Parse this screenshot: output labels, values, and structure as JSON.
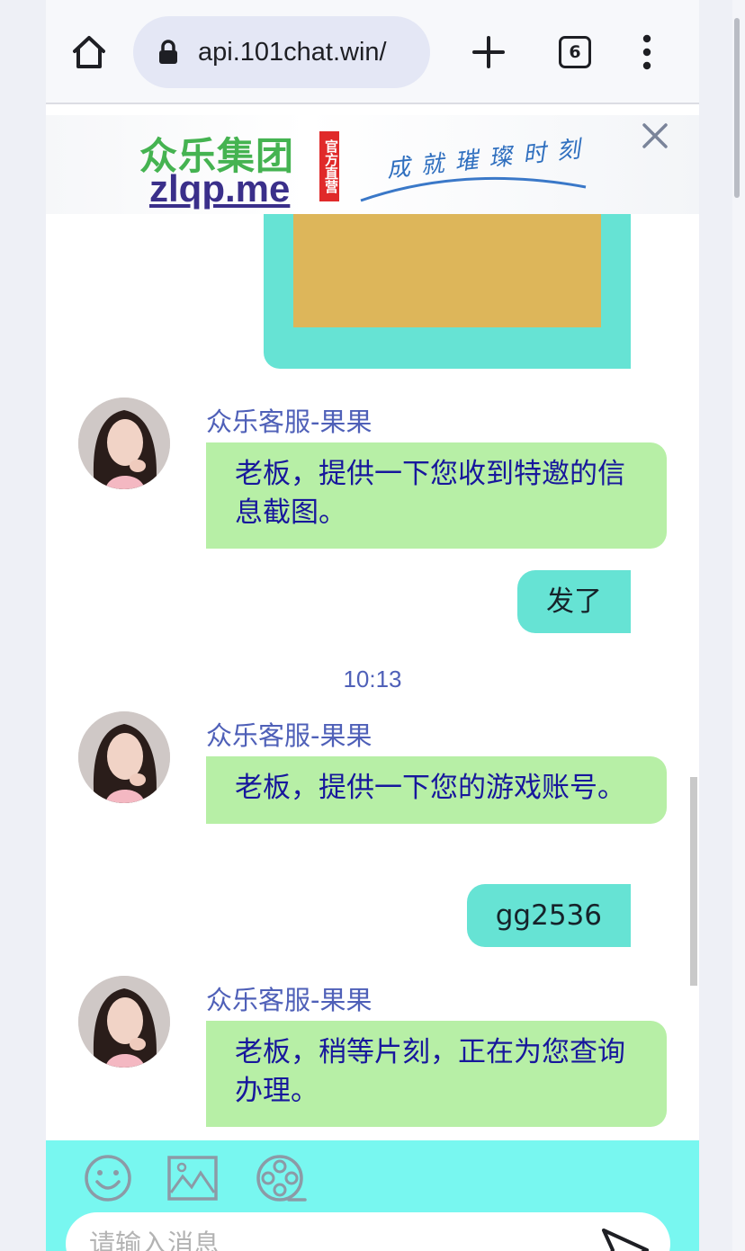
{
  "browser": {
    "url": "api.101chat.win/",
    "tab_count": "6"
  },
  "banner": {
    "brand_cn": "众乐集团",
    "brand_url": "zlqp.me",
    "official_tag": "官方直营",
    "slogan": "成就璀璨时刻"
  },
  "chat": {
    "messages": [
      {
        "sender": "众乐客服-果果",
        "text": "老板，提供一下您收到特邀的信息截图。"
      },
      {
        "text": "发了"
      },
      {
        "timestamp": "10:13"
      },
      {
        "sender": "众乐客服-果果",
        "text": "老板，提供一下您的游戏账号。"
      },
      {
        "text": "gg2536"
      },
      {
        "sender": "众乐客服-果果",
        "text": "老板，稍等片刻，正在为您查询办理。"
      }
    ]
  },
  "composer": {
    "placeholder": "请输入消息"
  },
  "colors": {
    "incoming_bubble": "#b7efa6",
    "outgoing_bubble": "#66e3d4",
    "toolbar": "#78f7f0",
    "sender_name": "#4f60b8"
  }
}
